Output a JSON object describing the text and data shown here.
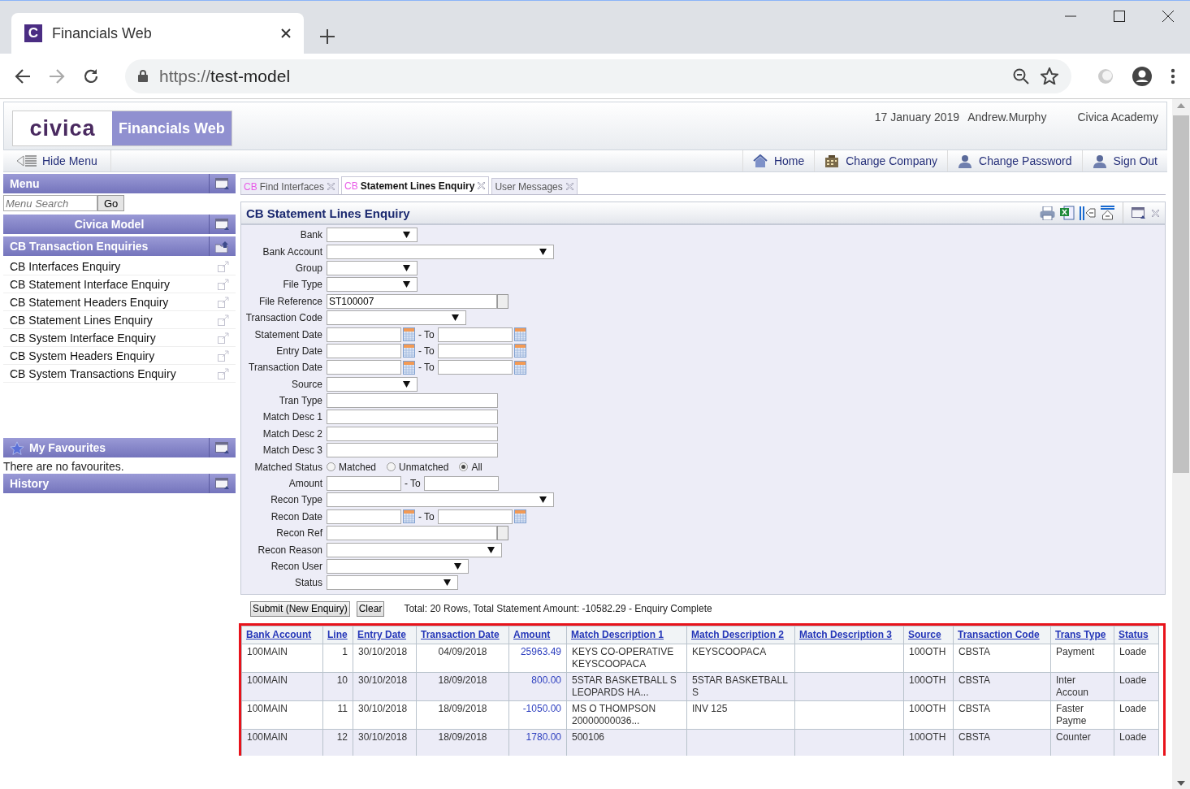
{
  "browser": {
    "tab_title": "Financials Web",
    "favicon_letter": "C",
    "url_scheme": "https://",
    "url_host": "test-model"
  },
  "header": {
    "logo": "civica",
    "product": "Financials Web",
    "date": "17 January 2019",
    "user": "Andrew.Murphy",
    "company": "Civica Academy"
  },
  "nav": {
    "hide_menu": "Hide Menu",
    "links": [
      "Home",
      "Change Company",
      "Change Password",
      "Sign Out"
    ]
  },
  "sidebar": {
    "menu_title": "Menu",
    "search_placeholder": "Menu Search",
    "search_button": "Go",
    "model_title": "Civica Model",
    "group_title": "CB Transaction Enquiries",
    "items": [
      "CB Interfaces Enquiry",
      "CB Statement Interface Enquiry",
      "CB Statement Headers Enquiry",
      "CB Statement Lines Enquiry",
      "CB System Interface Enquiry",
      "CB System Headers Enquiry",
      "CB System Transactions Enquiry"
    ],
    "favourites_title": "My Favourites",
    "favourites_text": "There are no favourites.",
    "history_title": "History"
  },
  "tabs": [
    {
      "prefix": "CB",
      "label": "Find Interfaces",
      "selected": false
    },
    {
      "prefix": "CB",
      "label": "Statement Lines Enquiry",
      "selected": true
    },
    {
      "label": "User Messages",
      "selected": false
    }
  ],
  "panel": {
    "title": "CB Statement Lines Enquiry"
  },
  "form": [
    {
      "label": "Bank",
      "kind": "select"
    },
    {
      "label": "Bank Account",
      "kind": "select"
    },
    {
      "label": "Group",
      "kind": "select"
    },
    {
      "label": "File Type",
      "kind": "select"
    },
    {
      "label": "File Reference",
      "kind": "lookup",
      "value": "ST100007"
    },
    {
      "label": "Transaction Code",
      "kind": "select"
    },
    {
      "label": "Statement Date",
      "kind": "daterange",
      "to_label": "- To"
    },
    {
      "label": "Entry Date",
      "kind": "daterange",
      "to_label": "- To"
    },
    {
      "label": "Transaction Date",
      "kind": "daterange",
      "to_label": "- To"
    },
    {
      "label": "Source",
      "kind": "select"
    },
    {
      "label": "Tran Type",
      "kind": "text"
    },
    {
      "label": "Match Desc 1",
      "kind": "text"
    },
    {
      "label": "Match Desc 2",
      "kind": "text"
    },
    {
      "label": "Match Desc 3",
      "kind": "text"
    },
    {
      "label": "Matched Status",
      "kind": "radio",
      "options": [
        {
          "label": "Matched",
          "selected": false
        },
        {
          "label": "Unmatched",
          "selected": false
        },
        {
          "label": "All",
          "selected": true
        }
      ]
    },
    {
      "label": "Amount",
      "kind": "range",
      "to_label": "- To"
    },
    {
      "label": "Recon Type",
      "kind": "select"
    },
    {
      "label": "Recon Date",
      "kind": "daterange",
      "to_label": "- To"
    },
    {
      "label": "Recon Ref",
      "kind": "lookup"
    },
    {
      "label": "Recon Reason",
      "kind": "select"
    },
    {
      "label": "Recon User",
      "kind": "select"
    },
    {
      "label": "Status",
      "kind": "select"
    }
  ],
  "actions": {
    "submit": "Submit (New Enquiry)",
    "clear": "Clear",
    "summary": "Total: 20 Rows, Total Statement Amount: -10582.29 - Enquiry Complete"
  },
  "table": {
    "columns": [
      "Bank Account",
      "Line",
      "Entry Date",
      "Transaction Date",
      "Amount",
      "Match Description 1",
      "Match Description 2",
      "Match Description 3",
      "Source",
      "Transaction Code",
      "Trans Type",
      "Status"
    ],
    "rows": [
      [
        "100MAIN",
        "1",
        "30/10/2018",
        "04/09/2018",
        "25963.49",
        "KEYS CO-OPERATIVE KEYSCOOPACA",
        "KEYSCOOPACA",
        "",
        "100OTH",
        "CBSTA",
        "Payment",
        "Loade"
      ],
      [
        "100MAIN",
        "10",
        "30/10/2018",
        "18/09/2018",
        "800.00",
        "5STAR BASKETBALL S LEOPARDS HA...",
        "5STAR BASKETBALL S",
        "",
        "100OTH",
        "CBSTA",
        "Inter Accoun",
        "Loade"
      ],
      [
        "100MAIN",
        "11",
        "30/10/2018",
        "18/09/2018",
        "-1050.00",
        "MS O THOMPSON 20000000036...",
        "INV 125",
        "",
        "100OTH",
        "CBSTA",
        "Faster Payme",
        "Loade"
      ],
      [
        "100MAIN",
        "12",
        "30/10/2018",
        "18/09/2018",
        "1780.00",
        "500106",
        "",
        "",
        "100OTH",
        "CBSTA",
        "Counter",
        "Loade"
      ]
    ]
  }
}
